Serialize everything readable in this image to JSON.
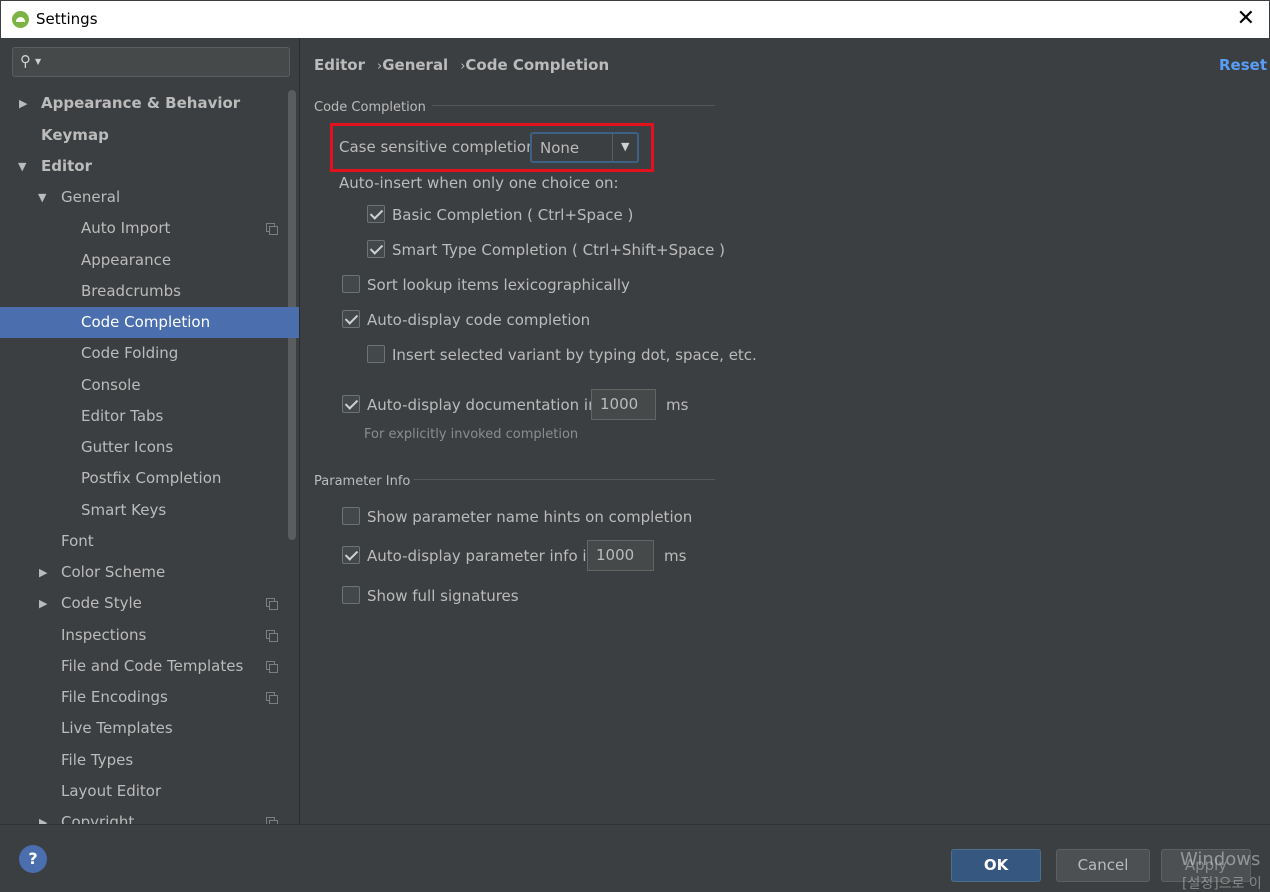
{
  "window": {
    "title": "Settings"
  },
  "sidebar": {
    "items": [
      {
        "label": "Appearance & Behavior"
      },
      {
        "label": "Keymap"
      },
      {
        "label": "Editor"
      },
      {
        "label": "General"
      },
      {
        "label": "Auto Import"
      },
      {
        "label": "Appearance"
      },
      {
        "label": "Breadcrumbs"
      },
      {
        "label": "Code Completion"
      },
      {
        "label": "Code Folding"
      },
      {
        "label": "Console"
      },
      {
        "label": "Editor Tabs"
      },
      {
        "label": "Gutter Icons"
      },
      {
        "label": "Postfix Completion"
      },
      {
        "label": "Smart Keys"
      },
      {
        "label": "Font"
      },
      {
        "label": "Color Scheme"
      },
      {
        "label": "Code Style"
      },
      {
        "label": "Inspections"
      },
      {
        "label": "File and Code Templates"
      },
      {
        "label": "File Encodings"
      },
      {
        "label": "Live Templates"
      },
      {
        "label": "File Types"
      },
      {
        "label": "Layout Editor"
      },
      {
        "label": "Copyright"
      }
    ]
  },
  "breadcrumb": {
    "items": [
      "Editor",
      "General",
      "Code Completion"
    ],
    "separator": "›"
  },
  "reset_label": "Reset",
  "code_completion": {
    "section_title": "Code Completion",
    "case_sensitive_label": "Case sensitive completion:",
    "case_sensitive_value": "None",
    "auto_insert_label": "Auto-insert when only one choice on:",
    "basic_completion": {
      "label": "Basic Completion ( Ctrl+Space )",
      "checked": true
    },
    "smart_completion": {
      "label": "Smart Type Completion ( Ctrl+Shift+Space )",
      "checked": true
    },
    "sort_lexico": {
      "label": "Sort lookup items lexicographically",
      "checked": false
    },
    "auto_display_completion": {
      "label": "Auto-display code completion",
      "checked": true
    },
    "insert_variant": {
      "label": "Insert selected variant by typing dot, space, etc.",
      "checked": false
    },
    "auto_display_doc": {
      "label": "Auto-display documentation in",
      "value": "1000",
      "unit": "ms",
      "checked": true
    },
    "doc_hint": "For explicitly invoked completion"
  },
  "parameter_info": {
    "section_title": "Parameter Info",
    "show_hints": {
      "label": "Show parameter name hints on completion",
      "checked": false
    },
    "auto_display_param": {
      "label": "Auto-display parameter info in",
      "value": "1000",
      "unit": "ms",
      "checked": true
    },
    "full_signatures": {
      "label": "Show full signatures",
      "checked": false
    }
  },
  "buttons": {
    "ok": "OK",
    "cancel": "Cancel",
    "apply": "Apply",
    "help": "?"
  },
  "watermark": {
    "line1": "Windows",
    "line2": "[설정]으로 이"
  },
  "colors": {
    "selection": "#4b6eaf",
    "link": "#589df6",
    "highlight_box": "#e3101d",
    "background": "#3c3f41"
  }
}
